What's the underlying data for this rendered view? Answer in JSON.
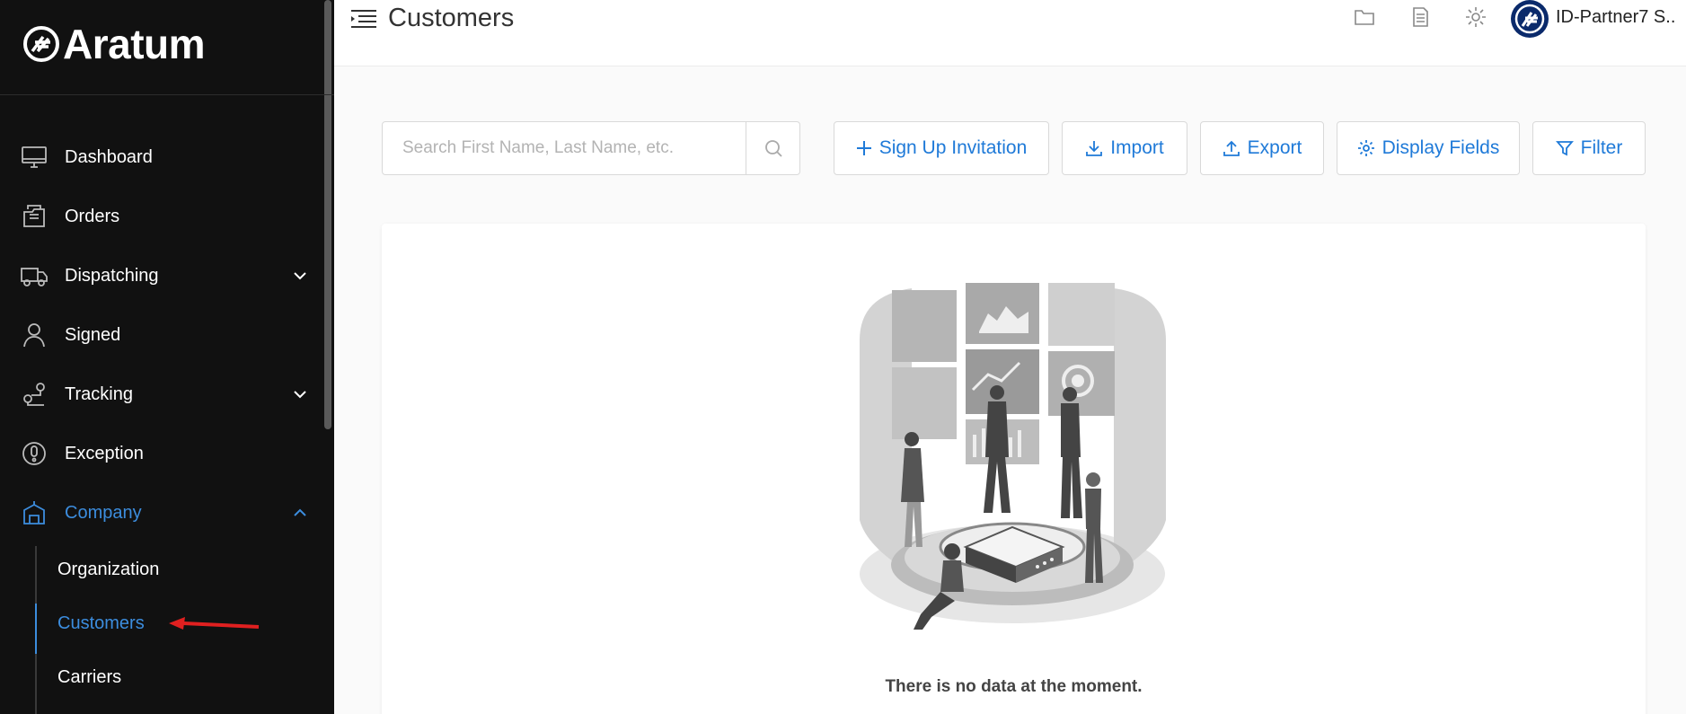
{
  "app": {
    "logo_text": "Aratum"
  },
  "sidebar": {
    "items": [
      {
        "label": "Dashboard",
        "icon": "monitor-icon"
      },
      {
        "label": "Orders",
        "icon": "orders-icon"
      },
      {
        "label": "Dispatching",
        "icon": "truck-icon",
        "expandable": true
      },
      {
        "label": "Signed",
        "icon": "person-icon"
      },
      {
        "label": "Tracking",
        "icon": "route-icon",
        "expandable": true
      },
      {
        "label": "Exception",
        "icon": "exclamation-icon"
      },
      {
        "label": "Company",
        "icon": "company-icon",
        "expanded": true,
        "active": true
      }
    ],
    "company_sub": [
      {
        "label": "Organization"
      },
      {
        "label": "Customers",
        "active": true
      },
      {
        "label": "Carriers"
      }
    ]
  },
  "header": {
    "title": "Customers",
    "user_name": "ID-Partner7 S.."
  },
  "toolbar": {
    "search_placeholder": "Search First Name, Last Name, etc.",
    "sign_up_label": "Sign Up Invitation",
    "import_label": "Import",
    "export_label": "Export",
    "display_fields_label": "Display Fields",
    "filter_label": "Filter"
  },
  "content": {
    "empty_message": "There is no data at the moment."
  },
  "colors": {
    "accent": "#1f7ad8",
    "sidebar_bg": "#111111",
    "active_nav": "#3c8dde",
    "annotation_arrow": "#e02020"
  }
}
